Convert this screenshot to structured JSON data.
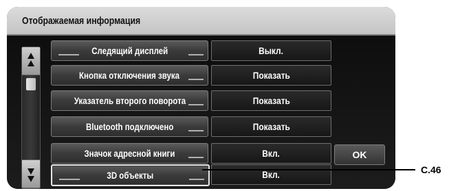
{
  "title": "Отображаемая информация",
  "rows": [
    {
      "label": "Следящий дисплей",
      "value": "Выкл."
    },
    {
      "label": "Кнопка отключения звука",
      "value": "Показать"
    },
    {
      "label": "Указатель второго поворота",
      "value": "Показать"
    },
    {
      "label": "Bluetooth подключено",
      "value": "Показать"
    },
    {
      "label": "Значок адресной книги",
      "value": "Вкл."
    },
    {
      "label": "3D объекты",
      "value": "Вкл."
    }
  ],
  "ok_label": "OK",
  "callout": "C.46",
  "scrollbar": {
    "up_icon": "arrow-up-icon",
    "down_icon": "arrow-down-icon"
  }
}
